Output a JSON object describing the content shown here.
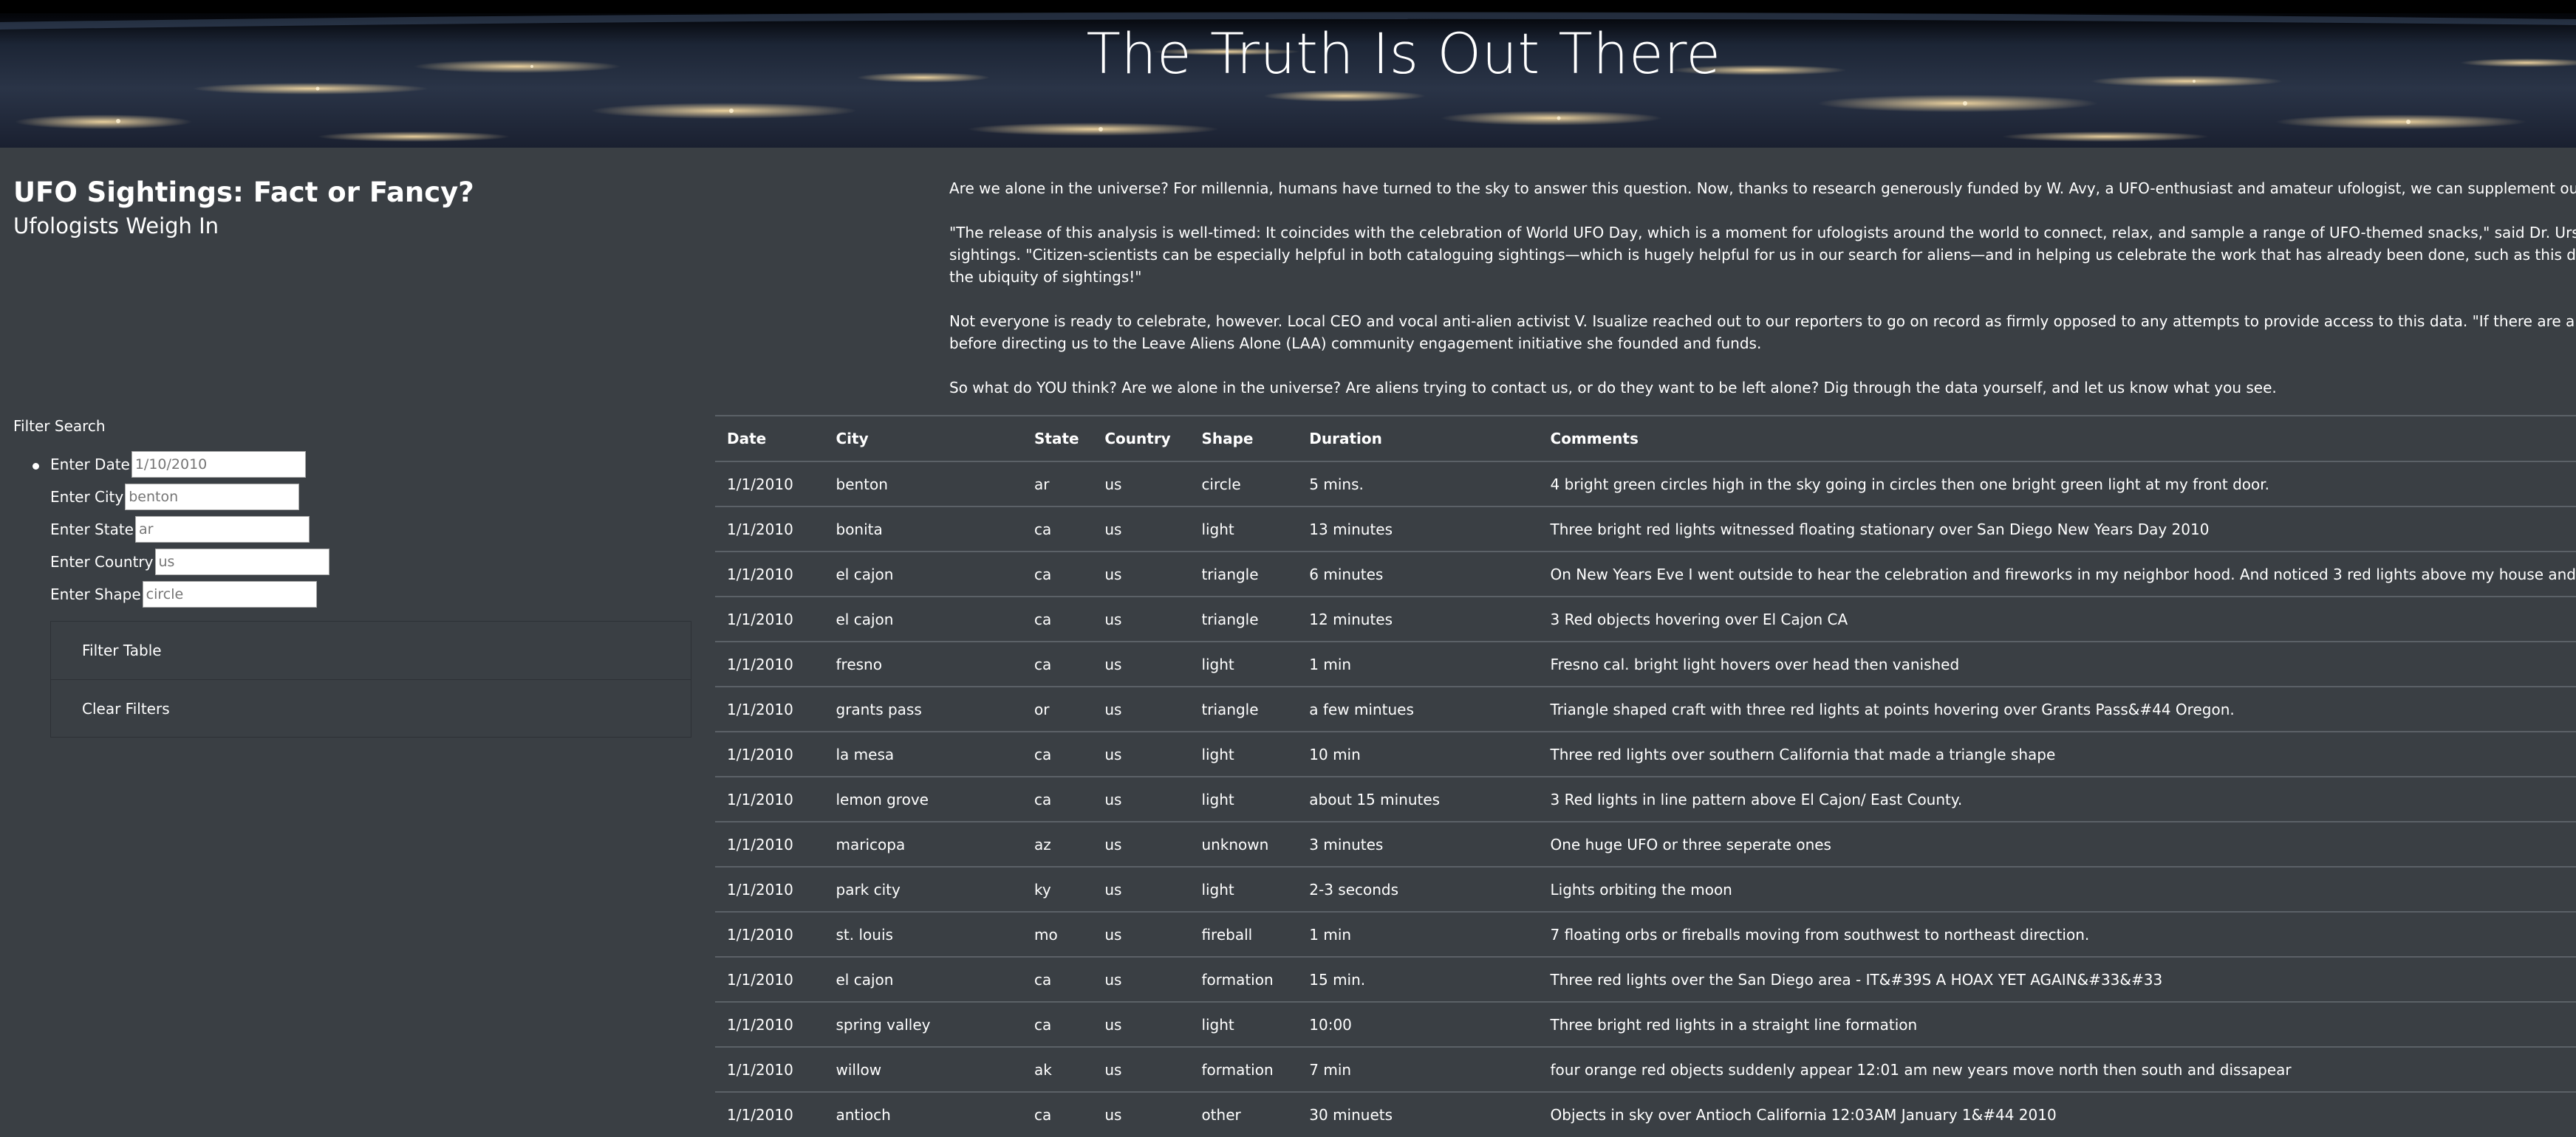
{
  "hero": {
    "title": "The Truth Is Out There"
  },
  "header": {
    "title": "UFO Sightings: Fact or Fancy?",
    "subtitle": "Ufologists Weigh In"
  },
  "filters": {
    "heading": "Filter Search",
    "fields": [
      {
        "label": "Enter Date",
        "placeholder": "1/10/2010"
      },
      {
        "label": "Enter City",
        "placeholder": "benton"
      },
      {
        "label": "Enter State",
        "placeholder": "ar"
      },
      {
        "label": "Enter Country",
        "placeholder": "us"
      },
      {
        "label": "Enter Shape",
        "placeholder": "circle"
      }
    ],
    "filter_button": "Filter Table",
    "clear_button": "Clear Filters"
  },
  "article": {
    "p1": "Are we alone in the universe? For millennia, humans have turned to the sky to answer this question. Now, thanks to research generously funded by W. Avy, a UFO-enthusiast and amateur ufologist, we can supplement our sky-searching with data analy",
    "p2_line1": "\"The release of this analysis is well-timed: It coincides with the celebration of World UFO Day, which is a moment for ufologists around the world to connect, relax, and sample a range of UFO-themed snacks,\" said Dr. Ursula F. Olivier, the world's prem",
    "p2_line2": "sightings. \"Citizen-scientists can be especially helpful in both cataloguing sightings—which is hugely helpful for us in our search for aliens—and in helping us celebrate the work that has already been done, such as this data visualization project, which",
    "p2_line3": "the ubiquity of sightings!\"",
    "p3_line1": "Not everyone is ready to celebrate, however. Local CEO and vocal anti-alien activist V. Isualize reached out to our reporters to go on record as firmly opposed to any attempts to provide access to this data. \"If there are aliens, they certainly would like t",
    "p3_line2": "before directing us to the Leave Aliens Alone (LAA) community engagement initiative she founded and funds.",
    "p4": "So what do YOU think? Are we alone in the universe? Are aliens trying to contact us, or do they want to be left alone? Dig through the data yourself, and let us know what you see."
  },
  "table": {
    "headers": [
      "Date",
      "City",
      "State",
      "Country",
      "Shape",
      "Duration",
      "Comments"
    ],
    "rows": [
      [
        "1/1/2010",
        "benton",
        "ar",
        "us",
        "circle",
        "5 mins.",
        "4 bright green circles high in the sky going in circles then one bright green light at my front door."
      ],
      [
        "1/1/2010",
        "bonita",
        "ca",
        "us",
        "light",
        "13 minutes",
        "Three bright red lights witnessed floating stationary over San Diego New Years Day 2010"
      ],
      [
        "1/1/2010",
        "el cajon",
        "ca",
        "us",
        "triangle",
        "6 minutes",
        "On New Years Eve I went outside to hear the celebration and fireworks in my neighbor hood. And noticed 3 red lights above my house and"
      ],
      [
        "1/1/2010",
        "el cajon",
        "ca",
        "us",
        "triangle",
        "12 minutes",
        "3 Red objects hovering over El Cajon CA"
      ],
      [
        "1/1/2010",
        "fresno",
        "ca",
        "us",
        "light",
        "1 min",
        "Fresno cal. bright light hovers over head then vanished"
      ],
      [
        "1/1/2010",
        "grants pass",
        "or",
        "us",
        "triangle",
        "a few mintues",
        "Triangle shaped craft with three red lights at points hovering over Grants Pass&#44 Oregon."
      ],
      [
        "1/1/2010",
        "la mesa",
        "ca",
        "us",
        "light",
        "10 min",
        "Three red lights over southern California that made a triangle shape"
      ],
      [
        "1/1/2010",
        "lemon grove",
        "ca",
        "us",
        "light",
        "about 15 minutes",
        "3 Red lights in line pattern above El Cajon/ East County."
      ],
      [
        "1/1/2010",
        "maricopa",
        "az",
        "us",
        "unknown",
        "3 minutes",
        "One huge UFO or three seperate ones"
      ],
      [
        "1/1/2010",
        "park city",
        "ky",
        "us",
        "light",
        "2-3 seconds",
        "Lights orbiting the moon"
      ],
      [
        "1/1/2010",
        "st. louis",
        "mo",
        "us",
        "fireball",
        "1 min",
        "7 floating orbs or fireballs moving from southwest to northeast direction."
      ],
      [
        "1/1/2010",
        "el cajon",
        "ca",
        "us",
        "formation",
        "15 min.",
        "Three red lights over the San Diego area - IT&#39S A HOAX YET AGAIN&#33&#33"
      ],
      [
        "1/1/2010",
        "spring valley",
        "ca",
        "us",
        "light",
        "10:00",
        "Three bright red lights in a straight line formation"
      ],
      [
        "1/1/2010",
        "willow",
        "ak",
        "us",
        "formation",
        "7 min",
        "four orange red objects suddenly appear 12:01 am new years move north then south and dissapear"
      ],
      [
        "1/1/2010",
        "antioch",
        "ca",
        "us",
        "other",
        "30 minuets",
        "Objects in sky over Antioch California 12:03AM January 1&#44 2010"
      ]
    ]
  }
}
